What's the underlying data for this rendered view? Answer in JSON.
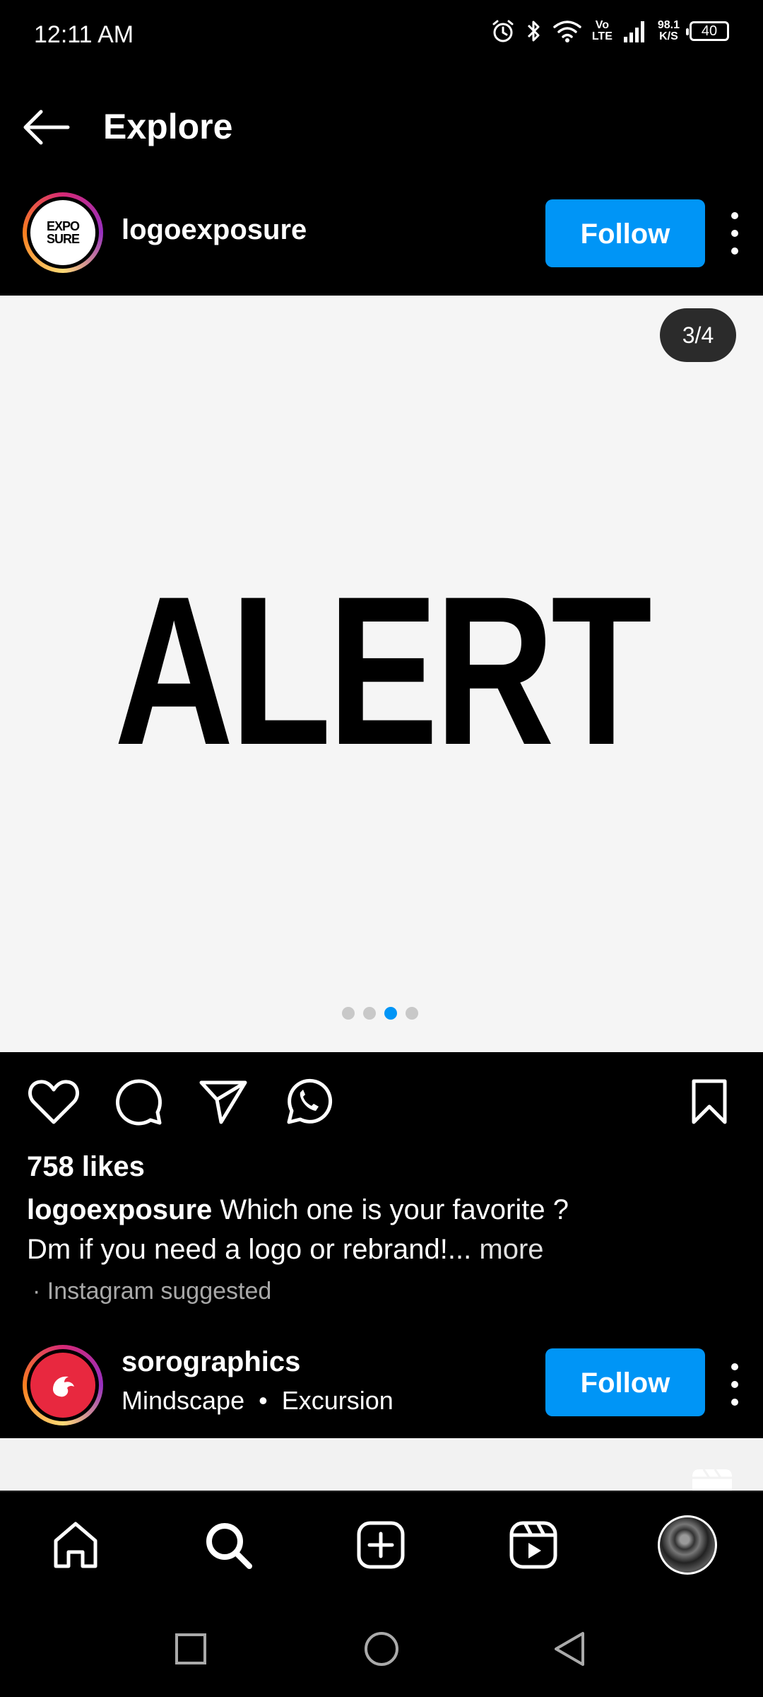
{
  "status_bar": {
    "time": "12:11 AM",
    "net_speed_value": "98.1",
    "net_speed_unit": "K/S",
    "battery": "40",
    "volte_top": "Vo",
    "volte_bottom": "LTE"
  },
  "header": {
    "title": "Explore"
  },
  "post": {
    "username": "logoexposure",
    "avatar_text_line1": "EXPO",
    "avatar_text_line2": "SURE",
    "follow_label": "Follow",
    "page_counter": "3/4",
    "image_text": "ALERT",
    "current_slide": 3,
    "total_slides": 4,
    "likes": "758 likes",
    "caption_user": "logoexposure",
    "caption_text": "Which one is your favorite ?",
    "caption_line2": "Dm if you need a logo or rebrand!...",
    "caption_more": "more",
    "suggested": "· Instagram suggested"
  },
  "post2": {
    "username": "sorographics",
    "subline_a": "Mindscape",
    "subline_sep": "•",
    "subline_b": "Excursion",
    "follow_label": "Follow"
  },
  "colors": {
    "accent": "#0095f6",
    "background": "#000000",
    "image_bg": "#f5f5f5"
  },
  "icons": {
    "actions": [
      "heart-icon",
      "comment-icon",
      "share-icon",
      "whatsapp-icon",
      "bookmark-icon"
    ],
    "bottom_nav": [
      "home-icon",
      "search-icon",
      "add-icon",
      "reels-icon",
      "profile-avatar"
    ],
    "system_nav": [
      "recents-icon",
      "home-circle-icon",
      "back-triangle-icon"
    ]
  }
}
